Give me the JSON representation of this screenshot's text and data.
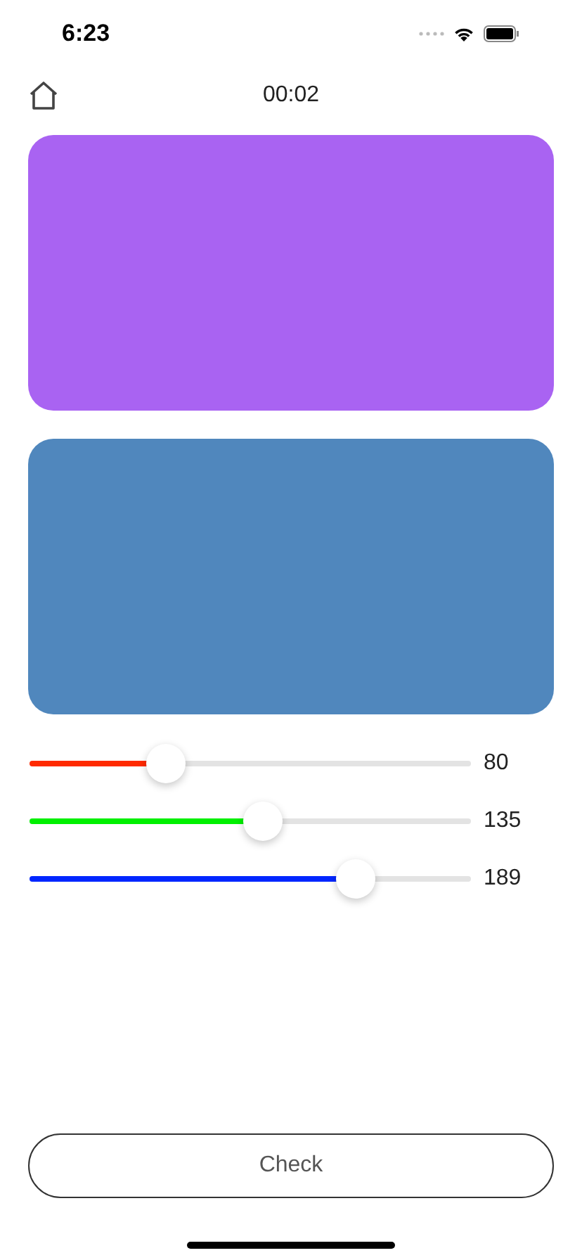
{
  "status_bar": {
    "time": "6:23"
  },
  "header": {
    "timer": "00:02"
  },
  "panels": [
    {
      "color": "#a963f2"
    },
    {
      "color": "#5087bd"
    }
  ],
  "sliders": [
    {
      "color": "#ff2a00",
      "level": 0.31,
      "reading": "80"
    },
    {
      "color": "#00f000",
      "level": 0.53,
      "reading": "135"
    },
    {
      "color": "#0026ff",
      "level": 0.74,
      "reading": "189"
    }
  ],
  "button": {
    "label": "Check"
  }
}
